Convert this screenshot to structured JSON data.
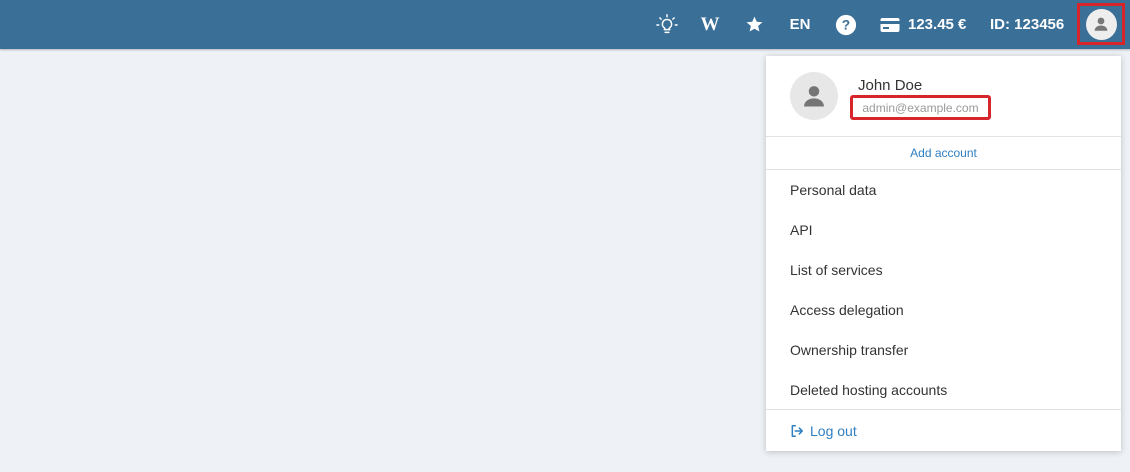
{
  "topbar": {
    "icons": {
      "tips": "lightbulb-icon",
      "wiki": "wiki-icon",
      "favorites": "star-icon",
      "help": "question-icon",
      "billing": "credit-card-icon",
      "avatar": "user-icon"
    },
    "wiki_label": "W",
    "language": "EN",
    "balance": "123.45 €",
    "user_id": "ID: 123456"
  },
  "user_menu": {
    "name": "John Doe",
    "email": "admin@example.com",
    "add_account": "Add account",
    "items": [
      {
        "label": "Personal data"
      },
      {
        "label": "API"
      },
      {
        "label": "List of services"
      },
      {
        "label": "Access delegation"
      },
      {
        "label": "Ownership transfer"
      },
      {
        "label": "Deleted hosting accounts"
      }
    ],
    "logout": "Log out"
  },
  "colors": {
    "topbar": "#3a6f97",
    "background": "#eef2f6",
    "link": "#2f7fc1",
    "highlight": "#d7262b"
  }
}
